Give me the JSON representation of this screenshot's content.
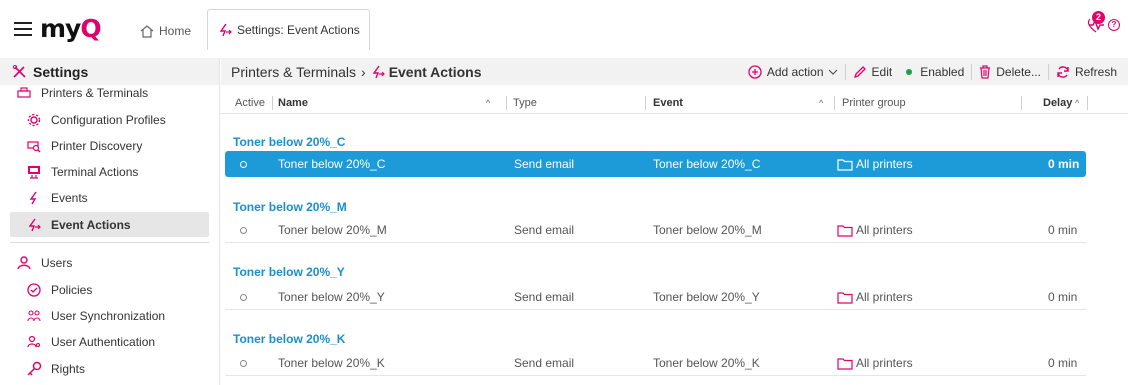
{
  "header": {
    "logo_prefix": "my",
    "logo_suffix": "Q",
    "home_label": "Home",
    "tab_label": "Settings: Event Actions",
    "notification_count": "2",
    "help_glyph": "?"
  },
  "sidebar": {
    "title": "Settings",
    "items": [
      {
        "label": "Printers & Terminals",
        "icon": "printer-icon"
      },
      {
        "label": "Configuration Profiles",
        "icon": "gear-icon"
      },
      {
        "label": "Printer Discovery",
        "icon": "printer-search-icon"
      },
      {
        "label": "Terminal Actions",
        "icon": "terminal-icon"
      },
      {
        "label": "Events",
        "icon": "lightning-icon"
      },
      {
        "label": "Event Actions",
        "icon": "event-action-icon"
      },
      {
        "label": "Users",
        "icon": "user-icon"
      },
      {
        "label": "Policies",
        "icon": "shield-check-icon"
      },
      {
        "label": "User Synchronization",
        "icon": "users-sync-icon"
      },
      {
        "label": "User Authentication",
        "icon": "user-key-icon"
      },
      {
        "label": "Rights",
        "icon": "key-icon"
      }
    ]
  },
  "toolbar": {
    "crumb_parent": "Printers & Terminals",
    "crumb_sep": "›",
    "crumb_current": "Event Actions",
    "add_action": "Add action",
    "edit": "Edit",
    "enabled": "Enabled",
    "delete": "Delete...",
    "refresh": "Refresh"
  },
  "table": {
    "columns": {
      "active": "Active",
      "name": "Name",
      "type": "Type",
      "event": "Event",
      "printer_group": "Printer group",
      "delay": "Delay"
    },
    "groups": [
      {
        "title": "Toner below 20%_C",
        "name": "Toner below 20%_C",
        "type": "Send email",
        "event": "Toner below 20%_C",
        "printer_group": "All printers",
        "delay": "0 min",
        "selected": true
      },
      {
        "title": "Toner below 20%_M",
        "name": "Toner below 20%_M",
        "type": "Send email",
        "event": "Toner below 20%_M",
        "printer_group": "All printers",
        "delay": "0 min",
        "selected": false
      },
      {
        "title": "Toner below 20%_Y",
        "name": "Toner below 20%_Y",
        "type": "Send email",
        "event": "Toner below 20%_Y",
        "printer_group": "All printers",
        "delay": "0 min",
        "selected": false
      },
      {
        "title": "Toner below 20%_K",
        "name": "Toner below 20%_K",
        "type": "Send email",
        "event": "Toner below 20%_K",
        "printer_group": "All printers",
        "delay": "0 min",
        "selected": false
      }
    ]
  },
  "colors": {
    "brand": "#e2006a",
    "accent": "#1c9bd8",
    "group_title": "#1a8fd0",
    "enabled": "#1ca04a"
  }
}
